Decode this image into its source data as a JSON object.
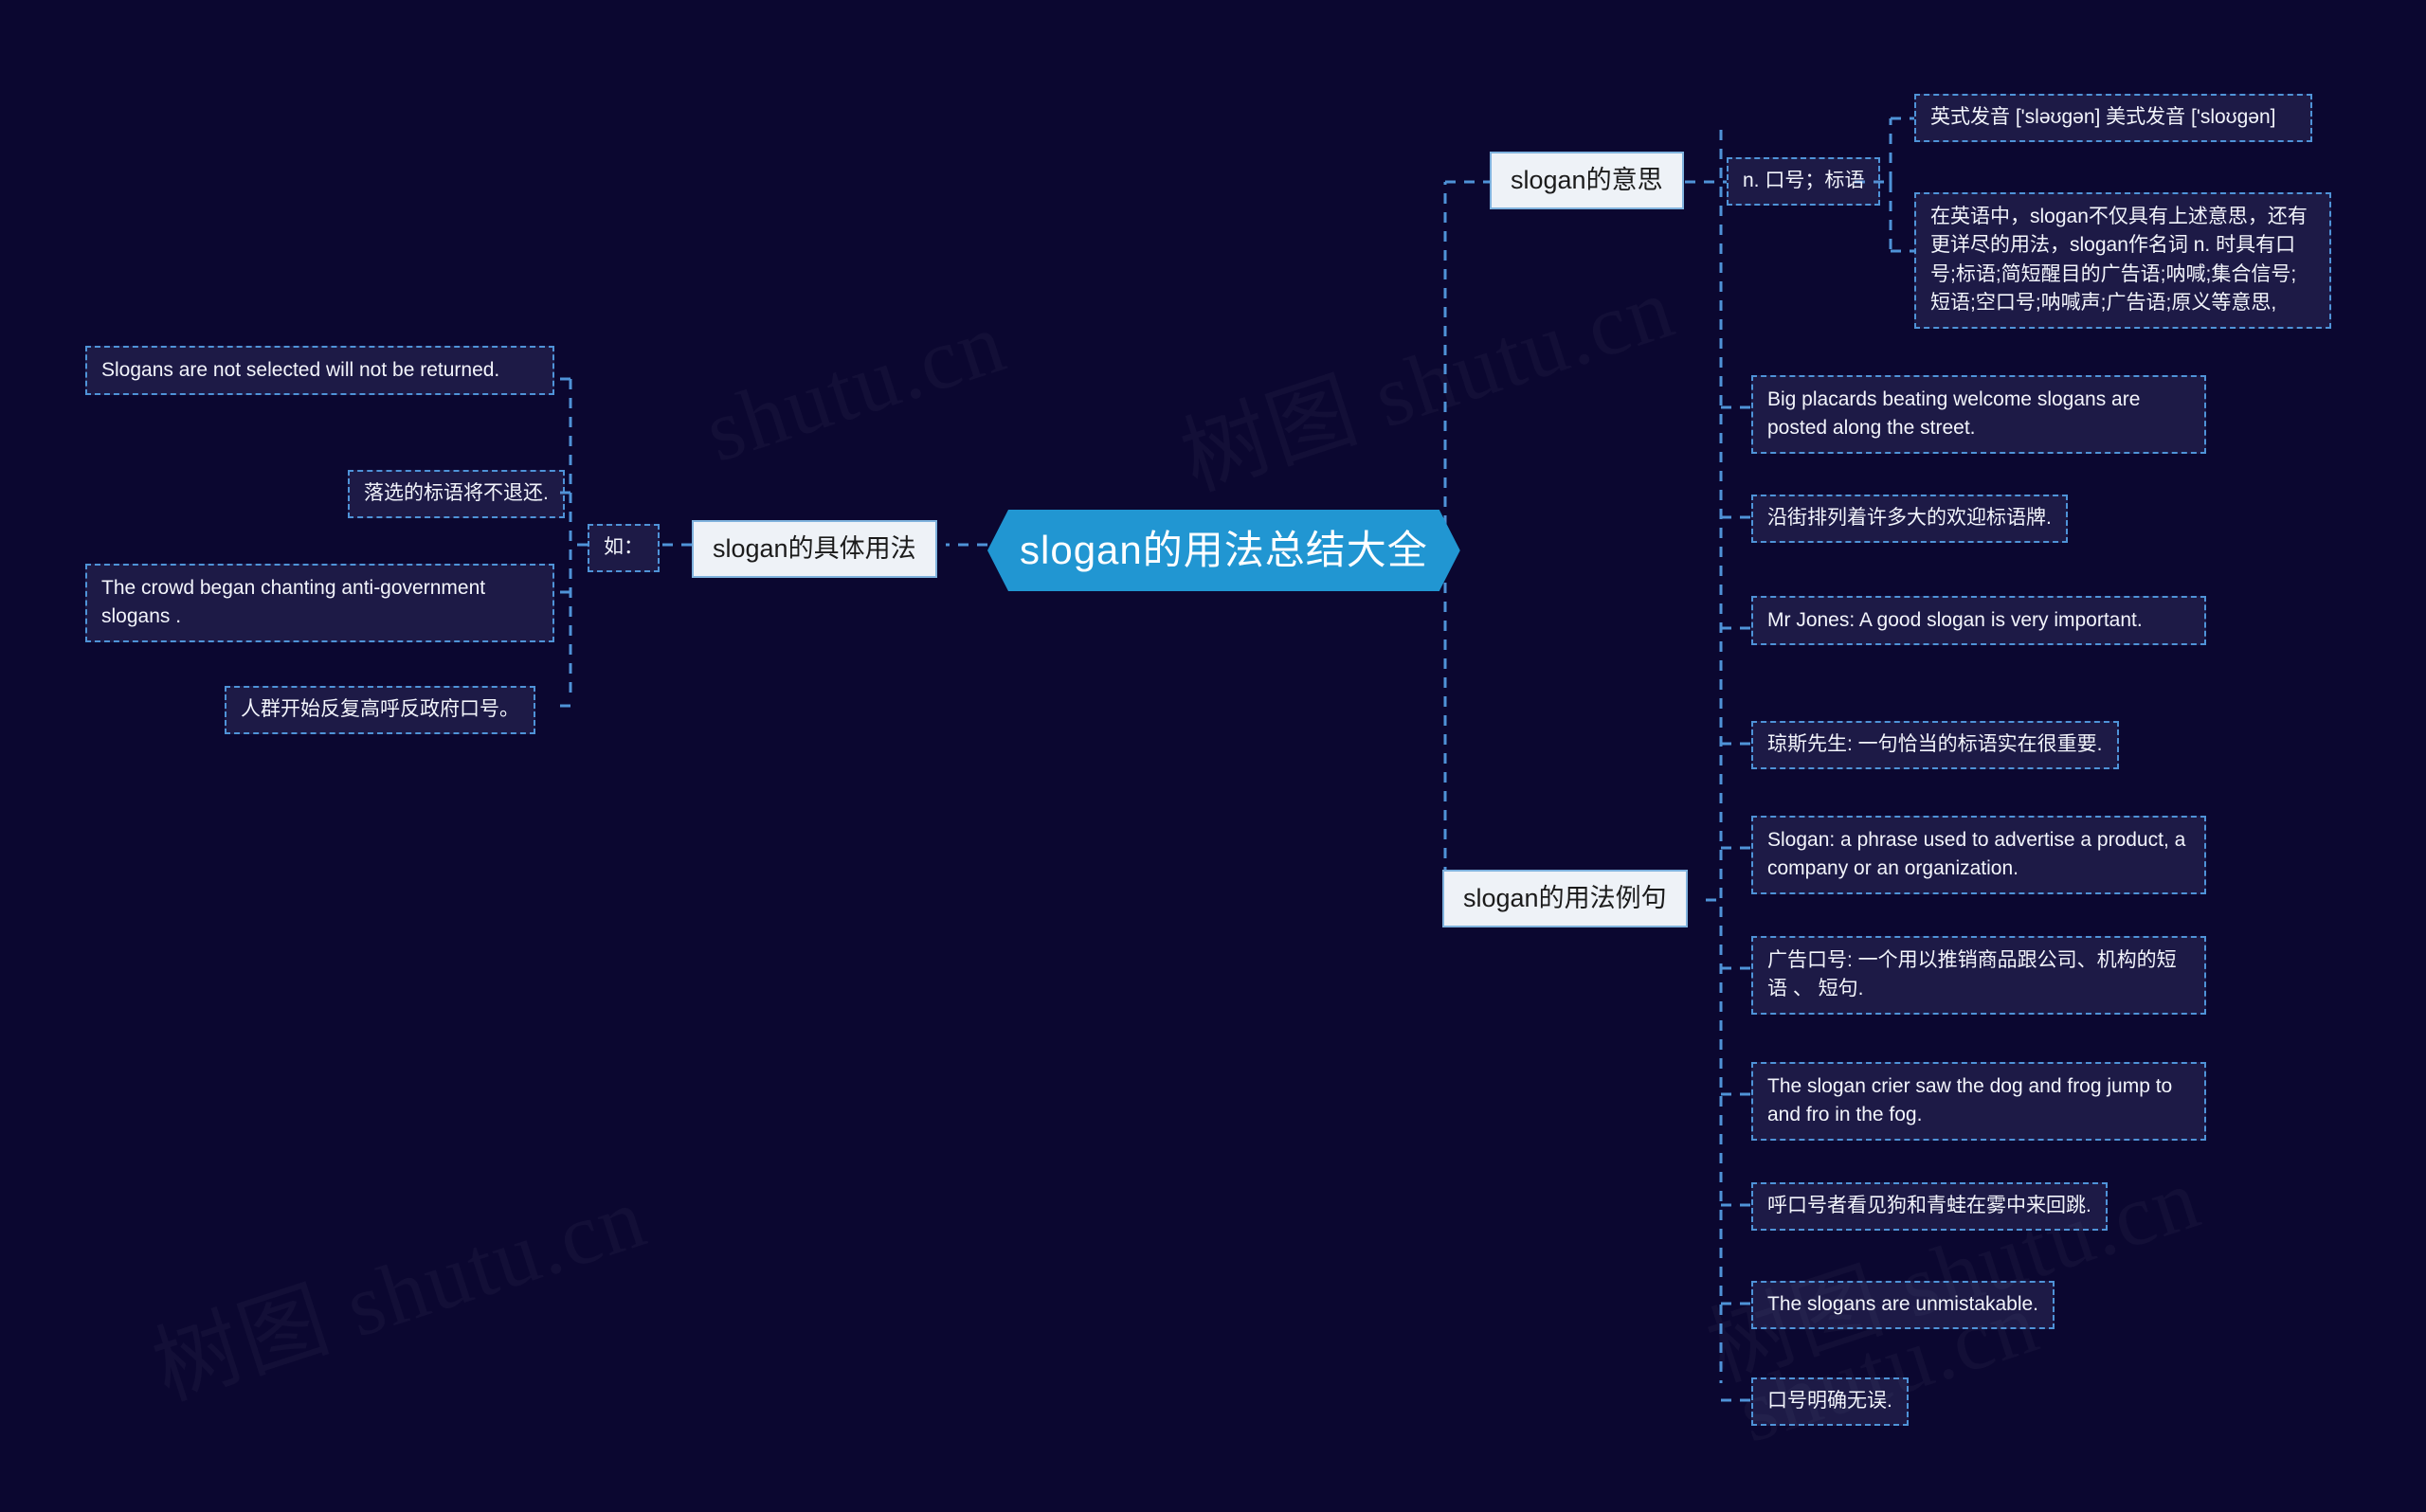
{
  "meta": {
    "background_color": "#0b0730",
    "accent_color": "#2196d2",
    "branch_line_color": "#4f93d8",
    "topic_bg": "#eef2f7",
    "leaf_bg": "rgba(120,125,185,0.17)",
    "watermark_text": "树图 shutu.cn"
  },
  "watermarks": [
    {
      "text": "shutu.cn"
    },
    {
      "text": "树图 shutu.cn"
    },
    {
      "text": "树图 shutu.cn"
    },
    {
      "text": "树图 shutu.cn"
    },
    {
      "text": "shutu.cn"
    }
  ],
  "root": {
    "label": "slogan的用法总结大全"
  },
  "branches": [
    {
      "id": "meaning",
      "label": "slogan的意思",
      "side": "right",
      "children": [
        {
          "label": "n. 口号；标语",
          "children": [
            {
              "label": "英式发音 ['sləʊgən] 美式发音 ['sloʊgən]"
            },
            {
              "label": "在英语中，slogan不仅具有上述意思，还有更详尽的用法，slogan作名词 n. 时具有口号;标语;简短醒目的广告语;呐喊;集合信号;短语;空口号;呐喊声;广告语;原义等意思,"
            }
          ]
        }
      ]
    },
    {
      "id": "examples",
      "label": "slogan的用法例句",
      "side": "right",
      "children": [
        {
          "label": "Big placards beating welcome slogans are posted along the street."
        },
        {
          "label": "沿街排列着许多大的欢迎标语牌."
        },
        {
          "label": "Mr Jones: A good slogan is very important."
        },
        {
          "label": "琼斯先生: 一句恰当的标语实在很重要."
        },
        {
          "label": "Slogan: a phrase used to advertise a product, a company or an organization."
        },
        {
          "label": "广告口号: 一个用以推销商品跟公司、机构的短语 、 短句."
        },
        {
          "label": "The slogan crier saw the dog and frog jump to and fro in the fog."
        },
        {
          "label": "呼口号者看见狗和青蛙在雾中来回跳."
        },
        {
          "label": "The slogans are unmistakable."
        },
        {
          "label": "口号明确无误."
        }
      ]
    },
    {
      "id": "usage",
      "label": "slogan的具体用法",
      "side": "left",
      "children": [
        {
          "label": "如：",
          "children": [
            {
              "label": "Slogans are not selected will not be returned."
            },
            {
              "label": "落选的标语将不退还."
            },
            {
              "label": "The crowd began chanting anti-government slogans ."
            },
            {
              "label": "人群开始反复高呼反政府口号。"
            }
          ]
        }
      ]
    }
  ]
}
